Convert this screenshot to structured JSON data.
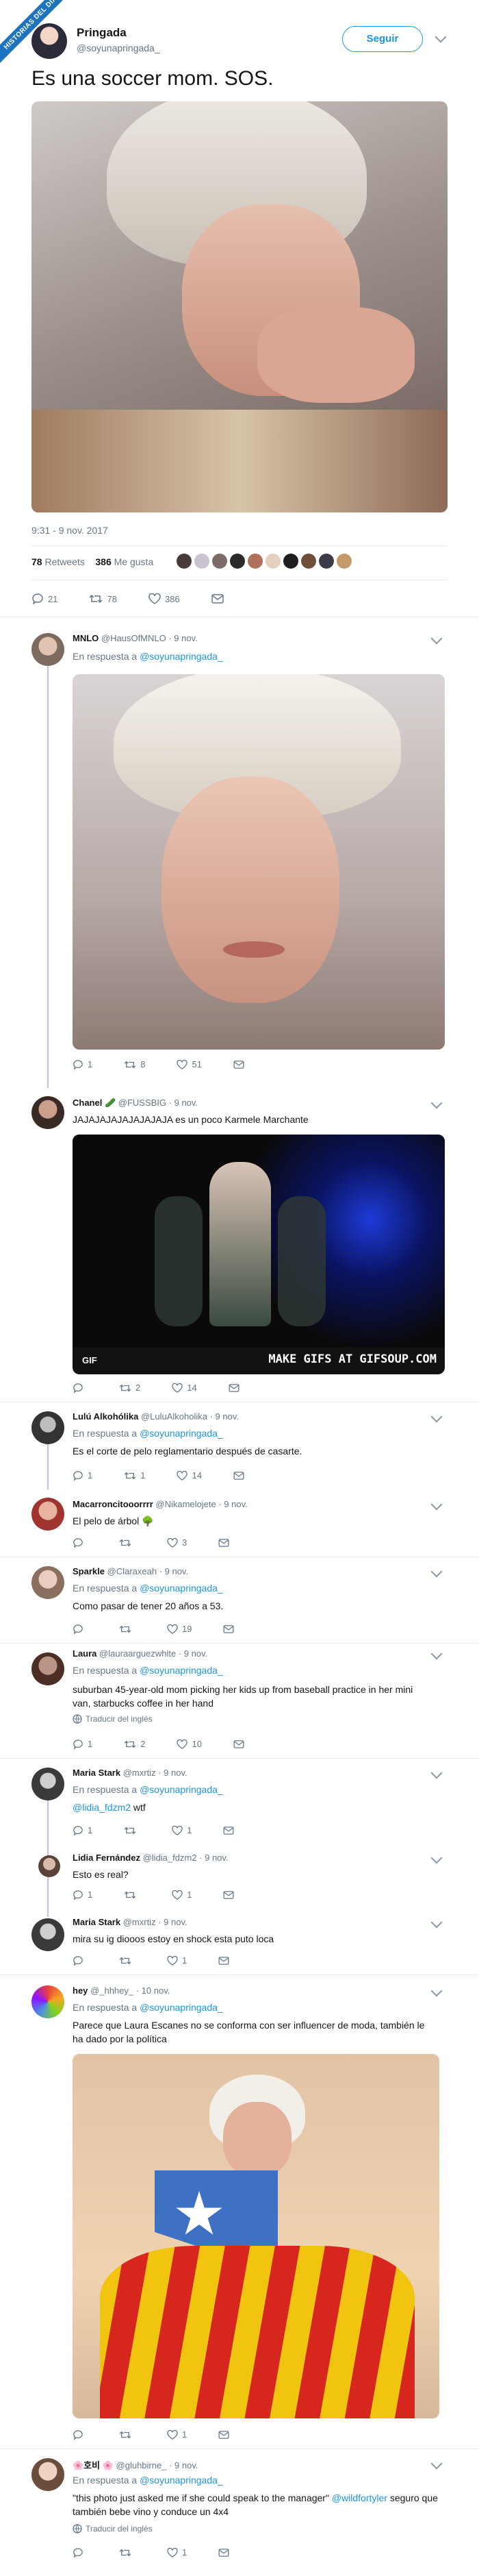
{
  "badge": "HISTORIAS DEL DIA",
  "main": {
    "name": "Pringada",
    "handle": "@soyunapringada_",
    "follow": "Seguir",
    "text": "Es una soccer mom. SOS.",
    "timestamp": "9:31 - 9 nov. 2017",
    "retweets_count": "78",
    "retweets_label": "Retweets",
    "likes_count": "386",
    "likes_label": "Me gusta",
    "replies": "21",
    "rts": "78",
    "likes": "386"
  },
  "replies": [
    {
      "name": "MNLO",
      "handle": "@HausOfMNLO",
      "time": "· 9 nov.",
      "reply_to_prefix": "En respuesta a",
      "reply_to": "@soyunapringada_",
      "text": "",
      "counts": [
        "1",
        "8",
        "51"
      ]
    },
    {
      "name": "Chanel 🥒",
      "handle": "@FUSSBIG",
      "time": "· 9 nov.",
      "text": "JAJAJAJAJAJAJAJAJA es un poco Karmele Marchante",
      "gif_label": "GIF",
      "gif_watermark": "MAKE GIFS AT GIFSOUP.COM",
      "counts": [
        "",
        "2",
        "14"
      ]
    },
    {
      "name": "Lulú Alkohólika",
      "handle": "@LuluAlkoholika",
      "time": "· 9 nov.",
      "reply_to_prefix": "En respuesta a",
      "reply_to": "@soyunapringada_",
      "text": "Es el corte de pelo reglamentario después de casarte.",
      "counts": [
        "1",
        "1",
        "14"
      ]
    },
    {
      "name": "Macarroncitooorrrr",
      "handle": "@Nikamelojete",
      "time": "· 9 nov.",
      "text": "El pelo de árbol 🌳",
      "counts": [
        "",
        "",
        "3"
      ]
    },
    {
      "name": "Sparkle",
      "handle": "@Claraxeah",
      "time": "· 9 nov.",
      "reply_to_prefix": "En respuesta a",
      "reply_to": "@soyunapringada_",
      "text": "Como pasar de tener 20 años a 53.",
      "counts": [
        "",
        "",
        "19"
      ]
    },
    {
      "name": "Laura",
      "handle": "@lauraarguezwhite",
      "time": "· 9 nov.",
      "reply_to_prefix": "En respuesta a",
      "reply_to": "@soyunapringada_",
      "text": "suburban 45-year-old mom picking her kids up from baseball practice in her mini van, starbucks coffee in her hand",
      "translate": "Traducir del inglés",
      "counts": [
        "1",
        "2",
        "10"
      ]
    },
    {
      "name": "Maria Stark",
      "handle": "@mxrtiz",
      "time": "· 9 nov.",
      "reply_to_prefix": "En respuesta a",
      "reply_to": "@soyunapringada_",
      "mention": "@lidia_fdzm2",
      "text": "wtf",
      "counts": [
        "1",
        "",
        "1"
      ]
    },
    {
      "name": "Lidia Fernández",
      "handle": "@lidia_fdzm2",
      "time": "· 9 nov.",
      "text": "Esto es real?",
      "counts": [
        "1",
        "",
        "1"
      ]
    },
    {
      "name": "Maria Stark",
      "handle": "@mxrtiz",
      "time": "· 9 nov.",
      "text": "mira su ig diooos estoy en shock esta puto loca",
      "counts": [
        "",
        "",
        "1"
      ]
    },
    {
      "name": "hey",
      "handle": "@_hhhey_",
      "time": "· 10 nov.",
      "reply_to_prefix": "En respuesta a",
      "reply_to": "@soyunapringada_",
      "text": "Parece que Laura Escanes no se conforma con ser influencer de moda, también le ha dado por la política",
      "counts": [
        "",
        "",
        "1"
      ]
    },
    {
      "name": "🌸호비 🌸",
      "handle": "@gluhbirne_",
      "time": "· 9 nov.",
      "reply_to_prefix": "En respuesta a",
      "reply_to": "@soyunapringada_",
      "text_a": "\"this photo just asked me if she could speak to the manager\"",
      "mention": "@wildfortyler",
      "text_b": "seguro que también bebe vino y conduce un 4x4",
      "translate": "Traducir del inglés",
      "counts": [
        "",
        "",
        "1"
      ]
    }
  ],
  "colors": {
    "accent": "#1b95e0",
    "text": "#14171a",
    "muted": "#657786",
    "thread": "#d6b6e8"
  }
}
